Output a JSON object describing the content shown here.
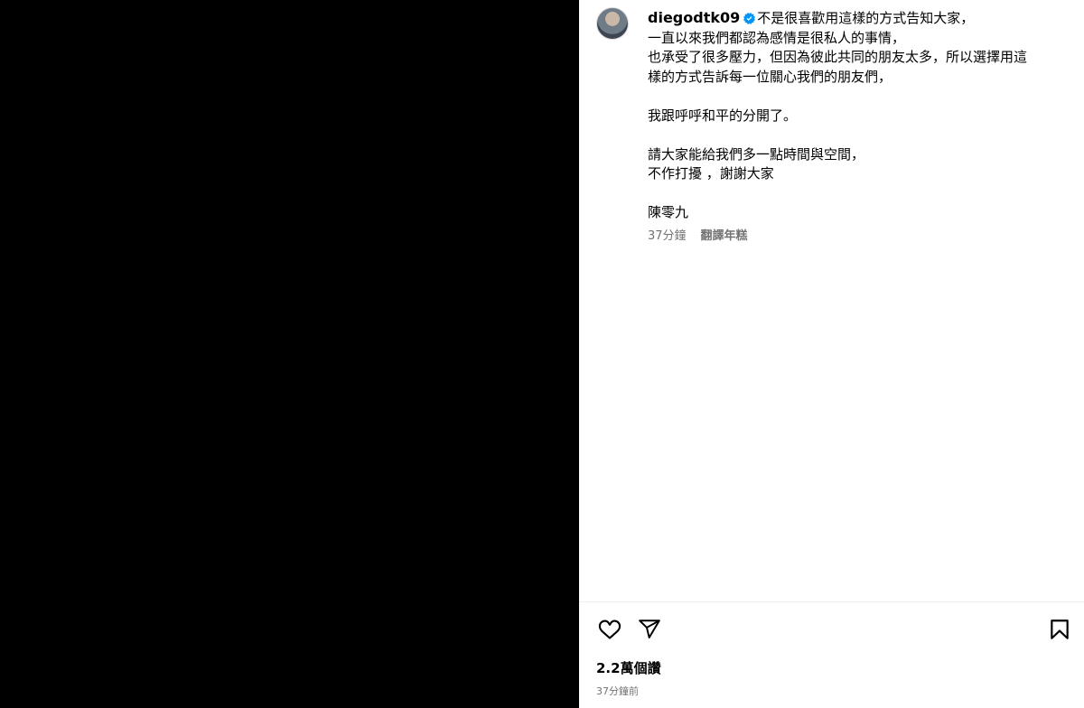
{
  "post": {
    "username": "diegodtk09",
    "caption_lines": [
      "不是很喜歡用這樣的方式告知大家，",
      "一直以來我們都認為感情是很私人的事情，",
      "也承受了很多壓力，但因為彼此共同的朋友太多，所以選擇用這",
      "樣的方式告訴每一位關心我們的朋友們，",
      "",
      "我跟呼呼和平的分開了。",
      "",
      "請大家能給我們多一點時間與空間，",
      "不作打擾 ，謝謝大家",
      "",
      "陳零九"
    ],
    "relative_time": "37分鐘",
    "translate_label": "翻譯年糕",
    "views": "2.2萬個讚",
    "posted_time": "37分鐘前"
  },
  "icons": {
    "verified": "verified-badge-icon",
    "like": "heart-icon",
    "share": "paper-plane-icon",
    "save": "bookmark-icon"
  },
  "colors": {
    "verified": "#0095f6",
    "secondary_text": "#737373",
    "media_bg": "#000000"
  }
}
